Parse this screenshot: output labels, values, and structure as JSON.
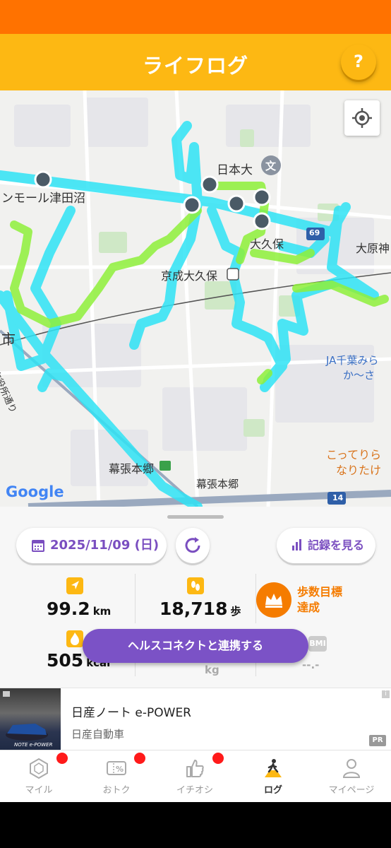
{
  "header": {
    "title": "ライフログ",
    "help_label": "?"
  },
  "map": {
    "labels": {
      "mall": "ンモール津田沼",
      "univ": "日本大",
      "univ_mark": "文",
      "okubo": "大久保",
      "ohara": "大原神",
      "station": "京成大久保",
      "city": "市",
      "ja": "JA千葉みら",
      "ja2": "か〜さ",
      "shiyakusho": "市役所通り",
      "makuhari_station": "幕張本郷",
      "makuhari": "幕張本郷",
      "kotteri": "こってりら",
      "naritake": "なりたけ",
      "route69": "69",
      "route14": "14",
      "google": "Google"
    }
  },
  "summary": {
    "date": "2025/11/09 (日)",
    "records_label": "記録を見る",
    "distance_value": "99.2",
    "distance_unit": "km",
    "steps_value": "18,718",
    "steps_unit": "歩",
    "goal_line1": "歩数目標",
    "goal_line2": "達成",
    "calories_value": "505",
    "calories_unit": "kcal",
    "bmi_label": "BMI",
    "bmi_value": "--.-",
    "weight_unit": "kg",
    "connect_label": "ヘルスコネクトと連携する"
  },
  "ad": {
    "title": "日産ノート e-POWER",
    "advertiser": "日産自動車",
    "image_text": "NOTE e-POWER",
    "pr_label": "PR",
    "info_label": "i"
  },
  "nav": [
    {
      "label": "マイル",
      "icon": "hexagon-icon"
    },
    {
      "label": "おトク",
      "icon": "coupon-icon"
    },
    {
      "label": "イチオシ",
      "icon": "thumbs-up-icon"
    },
    {
      "label": "ログ",
      "icon": "walker-icon"
    },
    {
      "label": "マイページ",
      "icon": "person-icon"
    }
  ],
  "colors": {
    "status_bar": "#ff7200",
    "header": "#fdb813",
    "accent_purple": "#7b52c6",
    "goal_orange": "#f57c00",
    "track_cyan": "#2fe3f5",
    "track_green": "#8ef03a",
    "badge_red": "#ff1a1a"
  }
}
